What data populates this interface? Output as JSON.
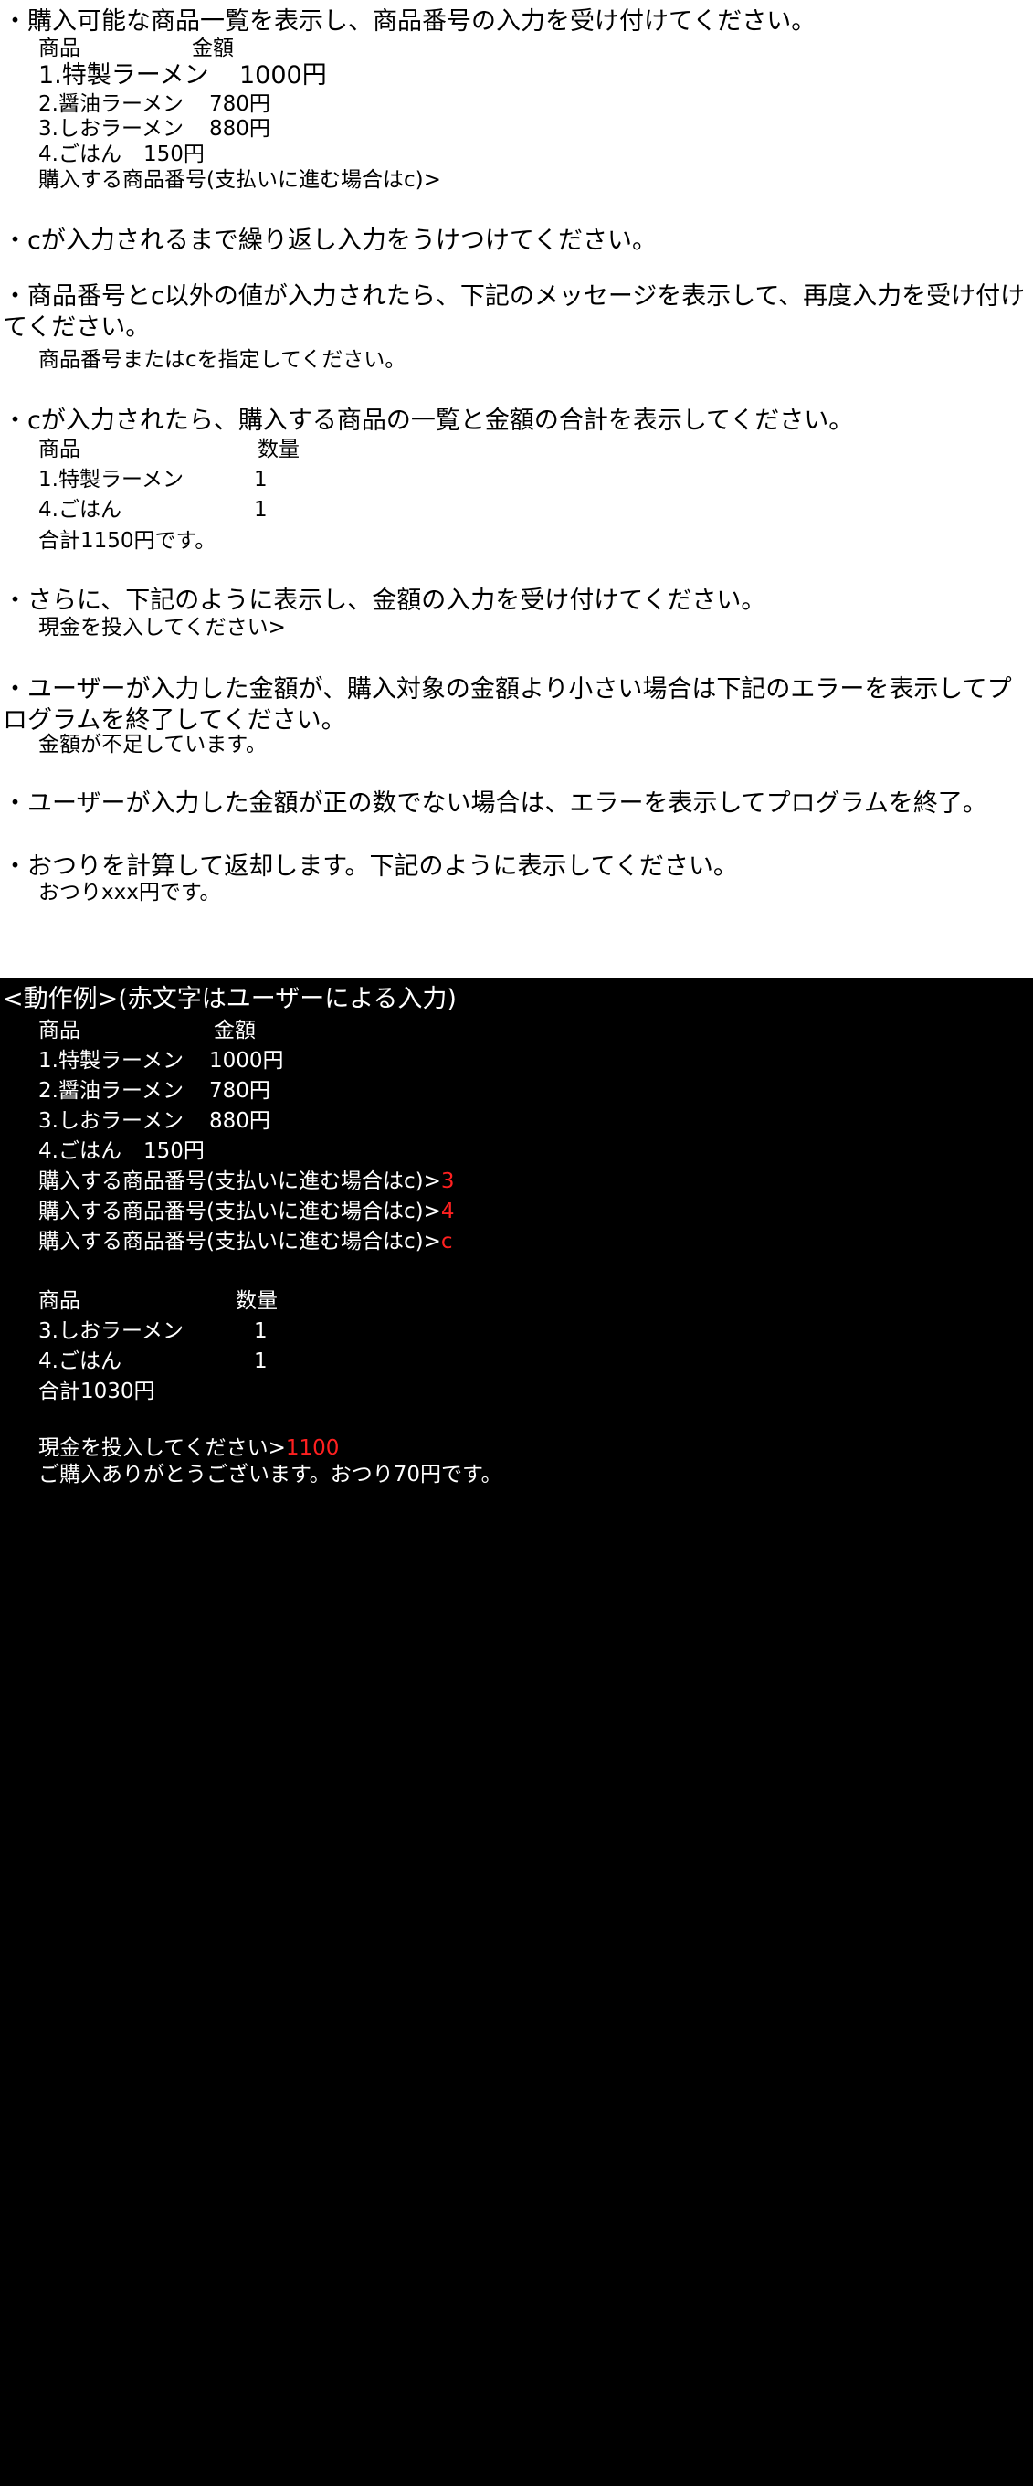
{
  "spec": {
    "b1": "・購入可能な商品一覧を表示し、商品番号の入力を受け付けてください。",
    "list_header": {
      "item": "商品",
      "price": "金額"
    },
    "items": [
      {
        "name": "1.特製ラーメン",
        "price": "1000円"
      },
      {
        "name": "2.醤油ラーメン",
        "price": "780円"
      },
      {
        "name": "3.しおラーメン",
        "price": "880円"
      },
      {
        "name": "4.ごはん",
        "price": "150円"
      }
    ],
    "prompt_select": "購入する商品番号(支払いに進む場合はc)>",
    "b2": "・cが入力されるまで繰り返し入力をうけつけてください。",
    "b3": "・商品番号とc以外の値が入力されたら、下記のメッセージを表示して、再度入力を受け付けてください。",
    "msg_invalid": "商品番号またはcを指定してください。",
    "b4": "・cが入力されたら、購入する商品の一覧と金額の合計を表示してください。",
    "summary_header": {
      "item": "商品",
      "qty": "数量"
    },
    "summary_rows": [
      {
        "name": "1.特製ラーメン",
        "qty": "1"
      },
      {
        "name": "4.ごはん",
        "qty": "1"
      }
    ],
    "total": "合計1150円です。",
    "b5": "・さらに、下記のように表示し、金額の入力を受け付けてください。",
    "prompt_cash": "現金を投入してください>",
    "b6": "・ユーザーが入力した金額が、購入対象の金額より小さい場合は下記のエラーを表示してプログラムを終了してください。",
    "msg_short": "金額が不足しています。",
    "b7": "・ユーザーが入力した金額が正の数でない場合は、エラーを表示してプログラムを終了。",
    "b8": "・おつりを計算して返却します。下記のように表示してください。",
    "msg_change": "おつりxxx円です。"
  },
  "terminal": {
    "title": "<動作例>(赤文字はユーザーによる入力)",
    "header": {
      "item": "商品",
      "price": "金額"
    },
    "items": [
      {
        "name": "1.特製ラーメン",
        "price": "1000円"
      },
      {
        "name": "2.醤油ラーメン",
        "price": "780円"
      },
      {
        "name": "3.しおラーメン",
        "price": "880円"
      },
      {
        "name": "4.ごはん",
        "price": "150円"
      }
    ],
    "prompt": "購入する商品番号(支払いに進む場合はc)>",
    "inputs": [
      "3",
      "4",
      "c"
    ],
    "summary_header": {
      "item": "商品",
      "qty": "数量"
    },
    "summary_rows": [
      {
        "name": "3.しおラーメン",
        "qty": "1"
      },
      {
        "name": "4.ごはん",
        "qty": "1"
      }
    ],
    "total": "合計1030円",
    "cash_prompt": "現金を投入してください>",
    "cash_input": "1100",
    "thanks": "ご購入ありがとうございます。おつり70円です。"
  }
}
